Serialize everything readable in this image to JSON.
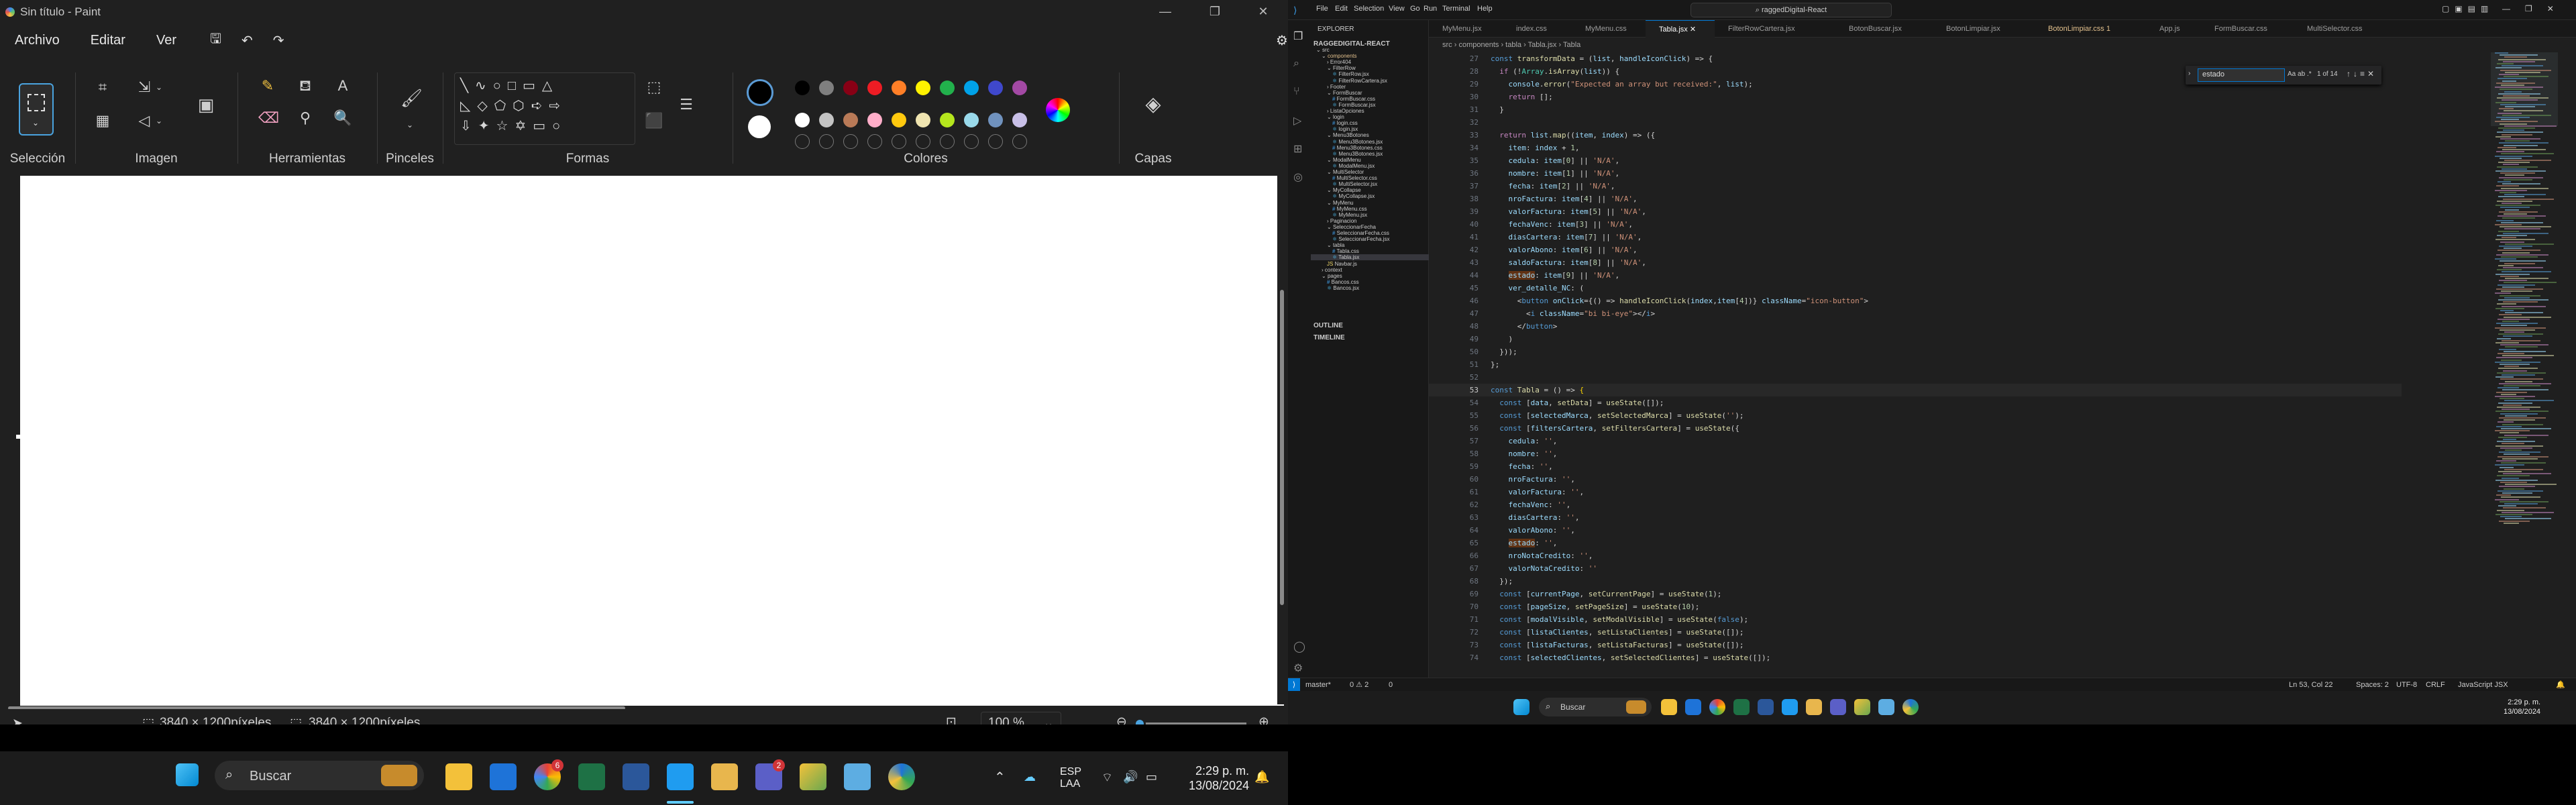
{
  "paint": {
    "window_title": "Sin título - Paint",
    "menu": [
      "Archivo",
      "Editar",
      "Ver"
    ],
    "groups": {
      "seleccion": "Selección",
      "imagen": "Imagen",
      "herramientas": "Herramientas",
      "pinceles": "Pinceles",
      "formas": "Formas",
      "colores": "Colores",
      "capas": "Capas"
    },
    "palette_row1": [
      "#000000",
      "#7f7f7f",
      "#880015",
      "#ed1c24",
      "#ff7f27",
      "#fff200",
      "#22b14c",
      "#00a2e8",
      "#3f48cc",
      "#a349a4"
    ],
    "palette_row2": [
      "#ffffff",
      "#c3c3c3",
      "#b97a57",
      "#ffaec9",
      "#ffc90e",
      "#efe4b0",
      "#b5e61d",
      "#99d9ea",
      "#7092be",
      "#c8bfe7"
    ],
    "status": {
      "selection_size": "3840 × 1200píxeles",
      "canvas_size": "3840 × 1200píxeles",
      "zoom": "100 %"
    }
  },
  "taskbar_left": {
    "search_placeholder": "Buscar",
    "lang1": "ESP",
    "lang2": "LAA",
    "time": "2:29 p. m.",
    "date": "13/08/2024",
    "chrome_badge": "6",
    "teams_badge": "2"
  },
  "vscode": {
    "menu": [
      "File",
      "Edit",
      "Selection",
      "View",
      "Go",
      "Run",
      "Terminal",
      "Help"
    ],
    "search": "raggedDigital-React",
    "explorer_title": "EXPLORER",
    "root": "RAGGEDIGITAL-REACT",
    "tree": [
      {
        "label": "src",
        "depth": 0,
        "kind": "folder-open"
      },
      {
        "label": "components",
        "depth": 1,
        "kind": "folder-open",
        "color": "#e2c08d"
      },
      {
        "label": "Error404",
        "depth": 2,
        "kind": "folder"
      },
      {
        "label": "FilterRow",
        "depth": 2,
        "kind": "folder-open"
      },
      {
        "label": "FilterRow.jsx",
        "depth": 3,
        "kind": "jsx"
      },
      {
        "label": "FilterRowCartera.jsx",
        "depth": 3,
        "kind": "jsx"
      },
      {
        "label": "Footer",
        "depth": 2,
        "kind": "folder"
      },
      {
        "label": "FormBuscar",
        "depth": 2,
        "kind": "folder-open"
      },
      {
        "label": "FormBuscar.css",
        "depth": 3,
        "kind": "css"
      },
      {
        "label": "FormBuscar.jsx",
        "depth": 3,
        "kind": "jsx"
      },
      {
        "label": "ListaOpciones",
        "depth": 2,
        "kind": "folder"
      },
      {
        "label": "login",
        "depth": 2,
        "kind": "folder-open"
      },
      {
        "label": "login.css",
        "depth": 3,
        "kind": "css"
      },
      {
        "label": "login.jsx",
        "depth": 3,
        "kind": "jsx"
      },
      {
        "label": "Menu3Botones",
        "depth": 2,
        "kind": "folder-open"
      },
      {
        "label": "Menu3Botones.jsx",
        "depth": 3,
        "kind": "jsx"
      },
      {
        "label": "Menu3Botones.css",
        "depth": 3,
        "kind": "css"
      },
      {
        "label": "Menu3Botones.jsx",
        "depth": 3,
        "kind": "jsx"
      },
      {
        "label": "ModalMenu",
        "depth": 2,
        "kind": "folder-open"
      },
      {
        "label": "ModalMenu.jsx",
        "depth": 3,
        "kind": "jsx"
      },
      {
        "label": "MultiSelector",
        "depth": 2,
        "kind": "folder-open"
      },
      {
        "label": "MultiSelector.css",
        "depth": 3,
        "kind": "css"
      },
      {
        "label": "MultiSelector.jsx",
        "depth": 3,
        "kind": "jsx"
      },
      {
        "label": "MyCollapse",
        "depth": 2,
        "kind": "folder-open"
      },
      {
        "label": "MyCollapse.jsx",
        "depth": 3,
        "kind": "jsx"
      },
      {
        "label": "MyMenu",
        "depth": 2,
        "kind": "folder-open"
      },
      {
        "label": "MyMenu.css",
        "depth": 3,
        "kind": "css"
      },
      {
        "label": "MyMenu.jsx",
        "depth": 3,
        "kind": "jsx"
      },
      {
        "label": "Paginacion",
        "depth": 2,
        "kind": "folder"
      },
      {
        "label": "SeleccionarFecha",
        "depth": 2,
        "kind": "folder-open"
      },
      {
        "label": "SeleccionarFecha.css",
        "depth": 3,
        "kind": "css"
      },
      {
        "label": "SeleccionarFecha.jsx",
        "depth": 3,
        "kind": "jsx"
      },
      {
        "label": "tabla",
        "depth": 2,
        "kind": "folder-open"
      },
      {
        "label": "Tabla.css",
        "depth": 3,
        "kind": "css"
      },
      {
        "label": "Tabla.jsx",
        "depth": 3,
        "kind": "jsx",
        "selected": true
      },
      {
        "label": "Navbar.js",
        "depth": 2,
        "kind": "js"
      },
      {
        "label": "context",
        "depth": 1,
        "kind": "folder"
      },
      {
        "label": "pages",
        "depth": 1,
        "kind": "folder-open"
      },
      {
        "label": "Bancos.css",
        "depth": 2,
        "kind": "css"
      },
      {
        "label": "Bancos.jsx",
        "depth": 2,
        "kind": "jsx"
      }
    ],
    "outline": "OUTLINE",
    "timeline": "TIMELINE",
    "tabs": [
      {
        "label": "MyMenu.jsx"
      },
      {
        "label": "index.css"
      },
      {
        "label": "MyMenu.css"
      },
      {
        "label": "Tabla.jsx",
        "active": true
      },
      {
        "label": "FilterRowCartera.jsx"
      },
      {
        "label": "BotonBuscar.jsx"
      },
      {
        "label": "BotonLimpiar.jsx"
      },
      {
        "label": "BotonLimpiar.css 1",
        "modified": true
      },
      {
        "label": "App.js"
      },
      {
        "label": "FormBuscar.css"
      },
      {
        "label": "MultiSelector.css"
      }
    ],
    "breadcrumb": [
      "src",
      "components",
      "tabla",
      "Tabla.jsx",
      "Tabla"
    ],
    "find": {
      "query": "estado",
      "count": "1 of 14"
    },
    "code": [
      {
        "n": "27",
        "html": "<span class='kw'>const</span> <span class='fn'>transformData</span> = (<span class='vr'>list</span>, <span class='vr'>handleIconClick</span>) => {"
      },
      {
        "n": "28",
        "html": "  <span class='cm'>if</span> (!<span class='tg'>Array</span>.<span class='fn'>isArray</span>(<span class='vr'>list</span>)) {"
      },
      {
        "n": "29",
        "html": "    <span class='vr'>console</span>.<span class='fn'>error</span>(<span class='st'>\"Expected an array but received:\"</span>, <span class='vr'>list</span>);"
      },
      {
        "n": "30",
        "html": "    <span class='cm'>return</span> [];"
      },
      {
        "n": "31",
        "html": "  }"
      },
      {
        "n": "32",
        "html": ""
      },
      {
        "n": "33",
        "html": "  <span class='cm'>return</span> <span class='vr'>list</span>.<span class='fn'>map</span>((<span class='vr'>item</span>, <span class='vr'>index</span>) => ({"
      },
      {
        "n": "34",
        "html": "    <span class='vr'>item</span>: <span class='vr'>index</span> + <span class='nm'>1</span>,"
      },
      {
        "n": "35",
        "html": "    <span class='vr'>cedula</span>: <span class='vr'>item</span>[<span class='nm'>0</span>] || <span class='st'>'N/A'</span>,"
      },
      {
        "n": "36",
        "html": "    <span class='vr'>nombre</span>: <span class='vr'>item</span>[<span class='nm'>1</span>] || <span class='st'>'N/A'</span>,"
      },
      {
        "n": "37",
        "html": "    <span class='vr'>fecha</span>: <span class='vr'>item</span>[<span class='nm'>2</span>] || <span class='st'>'N/A'</span>,"
      },
      {
        "n": "38",
        "html": "    <span class='vr'>nroFactura</span>: <span class='vr'>item</span>[<span class='nm'>4</span>] || <span class='st'>'N/A'</span>,"
      },
      {
        "n": "39",
        "html": "    <span class='vr'>valorFactura</span>: <span class='vr'>item</span>[<span class='nm'>5</span>] || <span class='st'>'N/A'</span>,"
      },
      {
        "n": "40",
        "html": "    <span class='vr'>fechaVenc</span>: <span class='vr'>item</span>[<span class='nm'>3</span>] || <span class='st'>'N/A'</span>,"
      },
      {
        "n": "41",
        "html": "    <span class='vr'>diasCartera</span>: <span class='vr'>item</span>[<span class='nm'>7</span>] || <span class='st'>'N/A'</span>,"
      },
      {
        "n": "42",
        "html": "    <span class='vr'>valorAbono</span>: <span class='vr'>item</span>[<span class='nm'>6</span>] || <span class='st'>'N/A'</span>,"
      },
      {
        "n": "43",
        "html": "    <span class='vr'>saldoFactura</span>: <span class='vr'>item</span>[<span class='nm'>8</span>] || <span class='st'>'N/A'</span>,"
      },
      {
        "n": "44",
        "html": "    <span class='vr hl'>estado</span>: <span class='vr'>item</span>[<span class='nm'>9</span>] || <span class='st'>'N/A'</span>,"
      },
      {
        "n": "45",
        "html": "    <span class='vr'>ver_detalle_NC</span>: ("
      },
      {
        "n": "46",
        "html": "      <span class='pu'>&lt;</span><span class='kw'>button</span> <span class='vr'>onClick</span>={() => <span class='fn'>handleIconClick</span>(<span class='vr'>index</span>,<span class='vr'>item</span>[<span class='nm'>4</span>])} <span class='vr'>className</span>=<span class='st'>\"icon-button\"</span><span class='pu'>&gt;</span>"
      },
      {
        "n": "47",
        "html": "        <span class='pu'>&lt;</span><span class='kw'>i</span> <span class='vr'>className</span>=<span class='st'>\"bi bi-eye\"</span><span class='pu'>&gt;&lt;/</span><span class='kw'>i</span><span class='pu'>&gt;</span>"
      },
      {
        "n": "48",
        "html": "      <span class='pu'>&lt;/</span><span class='kw'>button</span><span class='pu'>&gt;</span>"
      },
      {
        "n": "49",
        "html": "    )"
      },
      {
        "n": "50",
        "html": "  }));"
      },
      {
        "n": "51",
        "html": "};"
      },
      {
        "n": "52",
        "html": ""
      },
      {
        "n": "53",
        "html": "<span class='kw'>const</span> <span class='fn'>Tabla</span> = () => <span class='br'>{</span>"
      },
      {
        "n": "54",
        "html": "  <span class='kw'>const</span> [<span class='vr'>data</span>, <span class='fn'>setData</span>] = <span class='fn'>useState</span>([]);"
      },
      {
        "n": "55",
        "html": "  <span class='kw'>const</span> [<span class='vr'>selectedMarca</span>, <span class='fn'>setSelectedMarca</span>] = <span class='fn'>useState</span>(<span class='st'>''</span>);"
      },
      {
        "n": "56",
        "html": "  <span class='kw'>const</span> [<span class='vr'>filtersCartera</span>, <span class='fn'>setFiltersCartera</span>] = <span class='fn'>useState</span>({"
      },
      {
        "n": "57",
        "html": "    <span class='vr'>cedula</span>: <span class='st'>''</span>,"
      },
      {
        "n": "58",
        "html": "    <span class='vr'>nombre</span>: <span class='st'>''</span>,"
      },
      {
        "n": "59",
        "html": "    <span class='vr'>fecha</span>: <span class='st'>''</span>,"
      },
      {
        "n": "60",
        "html": "    <span class='vr'>nroFactura</span>: <span class='st'>''</span>,"
      },
      {
        "n": "61",
        "html": "    <span class='vr'>valorFactura</span>: <span class='st'>''</span>,"
      },
      {
        "n": "62",
        "html": "    <span class='vr'>fechaVenc</span>: <span class='st'>''</span>,"
      },
      {
        "n": "63",
        "html": "    <span class='vr'>diasCartera</span>: <span class='st'>''</span>,"
      },
      {
        "n": "64",
        "html": "    <span class='vr'>valorAbono</span>: <span class='st'>''</span>,"
      },
      {
        "n": "65",
        "html": "    <span class='vr hl'>estado</span>: <span class='st'>''</span>,"
      },
      {
        "n": "66",
        "html": "    <span class='vr'>nroNotaCredito</span>: <span class='st'>''</span>,"
      },
      {
        "n": "67",
        "html": "    <span class='vr'>valorNotaCredito</span>: <span class='st'>''</span>"
      },
      {
        "n": "68",
        "html": "  });"
      },
      {
        "n": "69",
        "html": "  <span class='kw'>const</span> [<span class='vr'>currentPage</span>, <span class='fn'>setCurrentPage</span>] = <span class='fn'>useState</span>(<span class='nm'>1</span>);"
      },
      {
        "n": "70",
        "html": "  <span class='kw'>const</span> [<span class='vr'>pageSize</span>, <span class='fn'>setPageSize</span>] = <span class='fn'>useState</span>(<span class='nm'>10</span>);"
      },
      {
        "n": "71",
        "html": "  <span class='kw'>const</span> [<span class='vr'>modalVisible</span>, <span class='fn'>setModalVisible</span>] = <span class='fn'>useState</span>(<span class='kw'>false</span>);"
      },
      {
        "n": "72",
        "html": "  <span class='kw'>const</span> [<span class='vr'>listaClientes</span>, <span class='fn'>setListaClientes</span>] = <span class='fn'>useState</span>([]);"
      },
      {
        "n": "73",
        "html": "  <span class='kw'>const</span> [<span class='vr'>listaFacturas</span>, <span class='fn'>setListaFacturas</span>] = <span class='fn'>useState</span>([]);"
      },
      {
        "n": "74",
        "html": "  <span class='kw'>const</span> [<span class='vr'>selectedClientes</span>, <span class='fn'>setSelectedClientes</span>] = <span class='fn'>useState</span>([]);"
      }
    ],
    "status": {
      "branch": "master*",
      "problems": "0 ⚠ 2",
      "ports": "0",
      "cursor": "Ln 53, Col 22",
      "spaces": "Spaces: 2",
      "encoding": "UTF-8",
      "eol": "CRLF",
      "language": "JavaScript JSX"
    }
  },
  "taskbar_right": {
    "search_placeholder": "Buscar",
    "time": "2:29 p. m.",
    "date": "13/08/2024"
  }
}
